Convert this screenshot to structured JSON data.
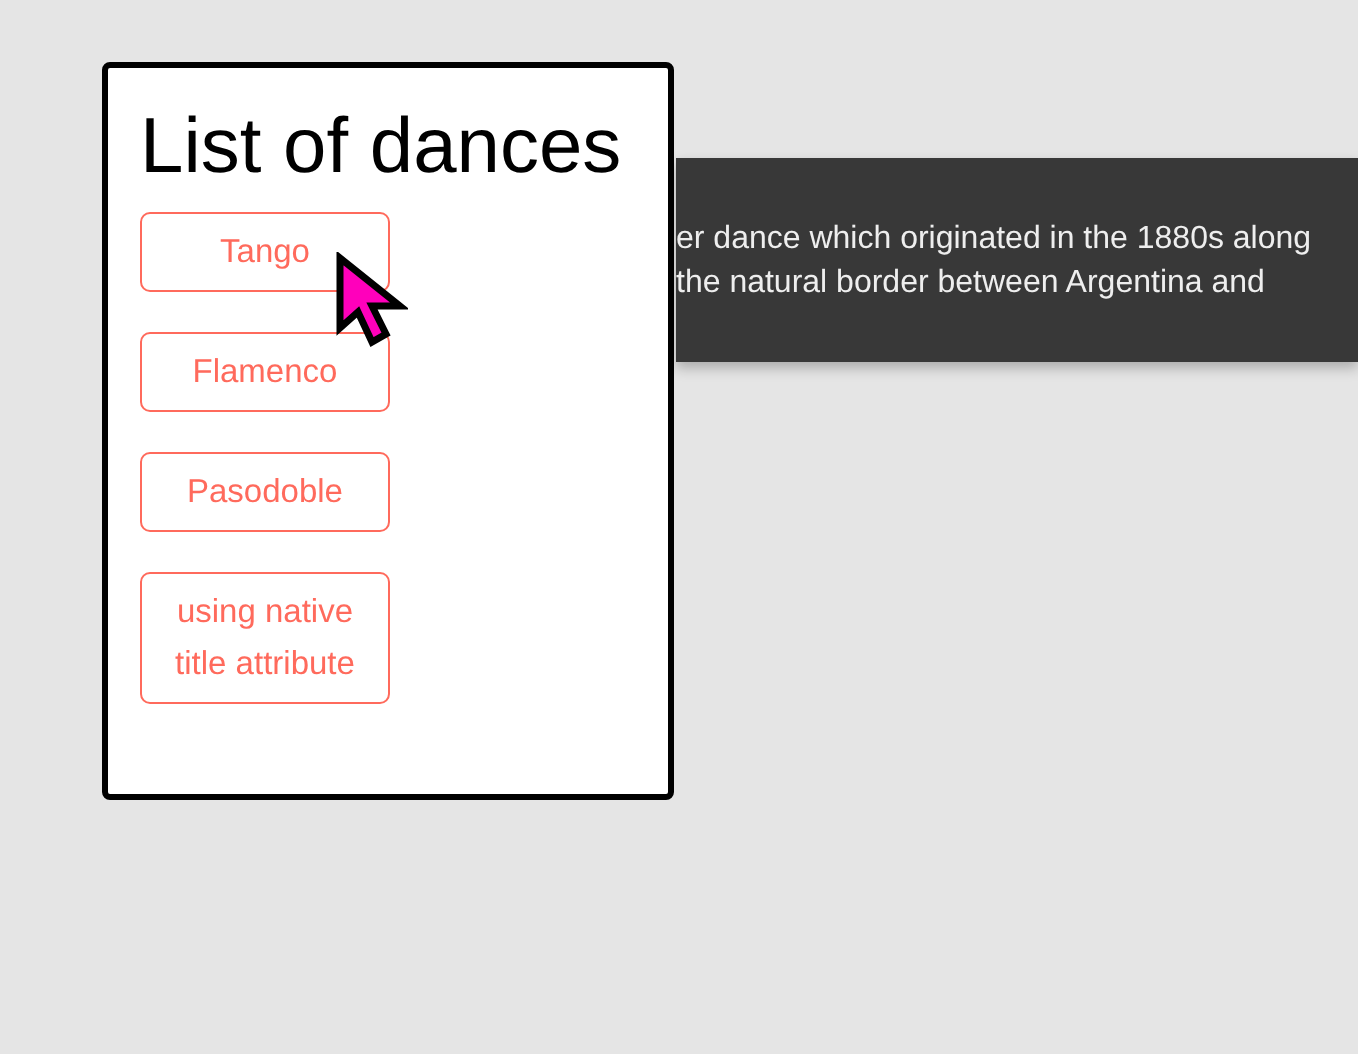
{
  "card": {
    "title": "List of dances",
    "buttons": [
      {
        "label": "Tango"
      },
      {
        "label": "Flamenco"
      },
      {
        "label": "Pasodoble"
      },
      {
        "label": "using native title attribute"
      }
    ]
  },
  "tooltip": {
    "lines": [
      "er dance which originated in the 1880s along",
      "the natural border between Argentina and"
    ]
  }
}
